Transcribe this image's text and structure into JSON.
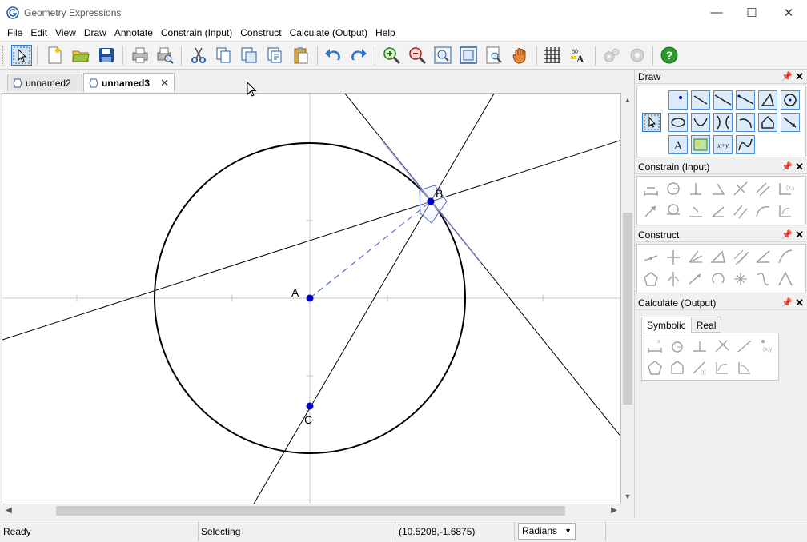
{
  "window": {
    "title": "Geometry Expressions",
    "minimize": "—",
    "maximize": "☐",
    "close": "✕"
  },
  "menu": {
    "items": [
      "File",
      "Edit",
      "View",
      "Draw",
      "Annotate",
      "Constrain (Input)",
      "Construct",
      "Calculate (Output)",
      "Help"
    ]
  },
  "tabs": [
    {
      "label": "unnamed2",
      "active": false
    },
    {
      "label": "unnamed3",
      "active": true,
      "close": "✕"
    }
  ],
  "canvas": {
    "points": [
      {
        "label": "A",
        "x": 0,
        "y": 0
      },
      {
        "label": "B",
        "x": 2.38,
        "y": 1.8
      },
      {
        "label": "C",
        "x": 0,
        "y": -2.1
      }
    ]
  },
  "panels": {
    "draw": {
      "title": "Draw"
    },
    "constrain": {
      "title": "Constrain (Input)"
    },
    "construct": {
      "title": "Construct"
    },
    "calculate": {
      "title": "Calculate (Output)",
      "tabs": [
        "Symbolic",
        "Real"
      ]
    }
  },
  "statusbar": {
    "ready": "Ready",
    "mode": "Selecting",
    "coords": "(10.5208,-1.6875)",
    "angle_unit": "Radians"
  },
  "colors": {
    "point": "#0000cc",
    "selection": "#5a6fd6",
    "accent": "#2b7bd2"
  }
}
